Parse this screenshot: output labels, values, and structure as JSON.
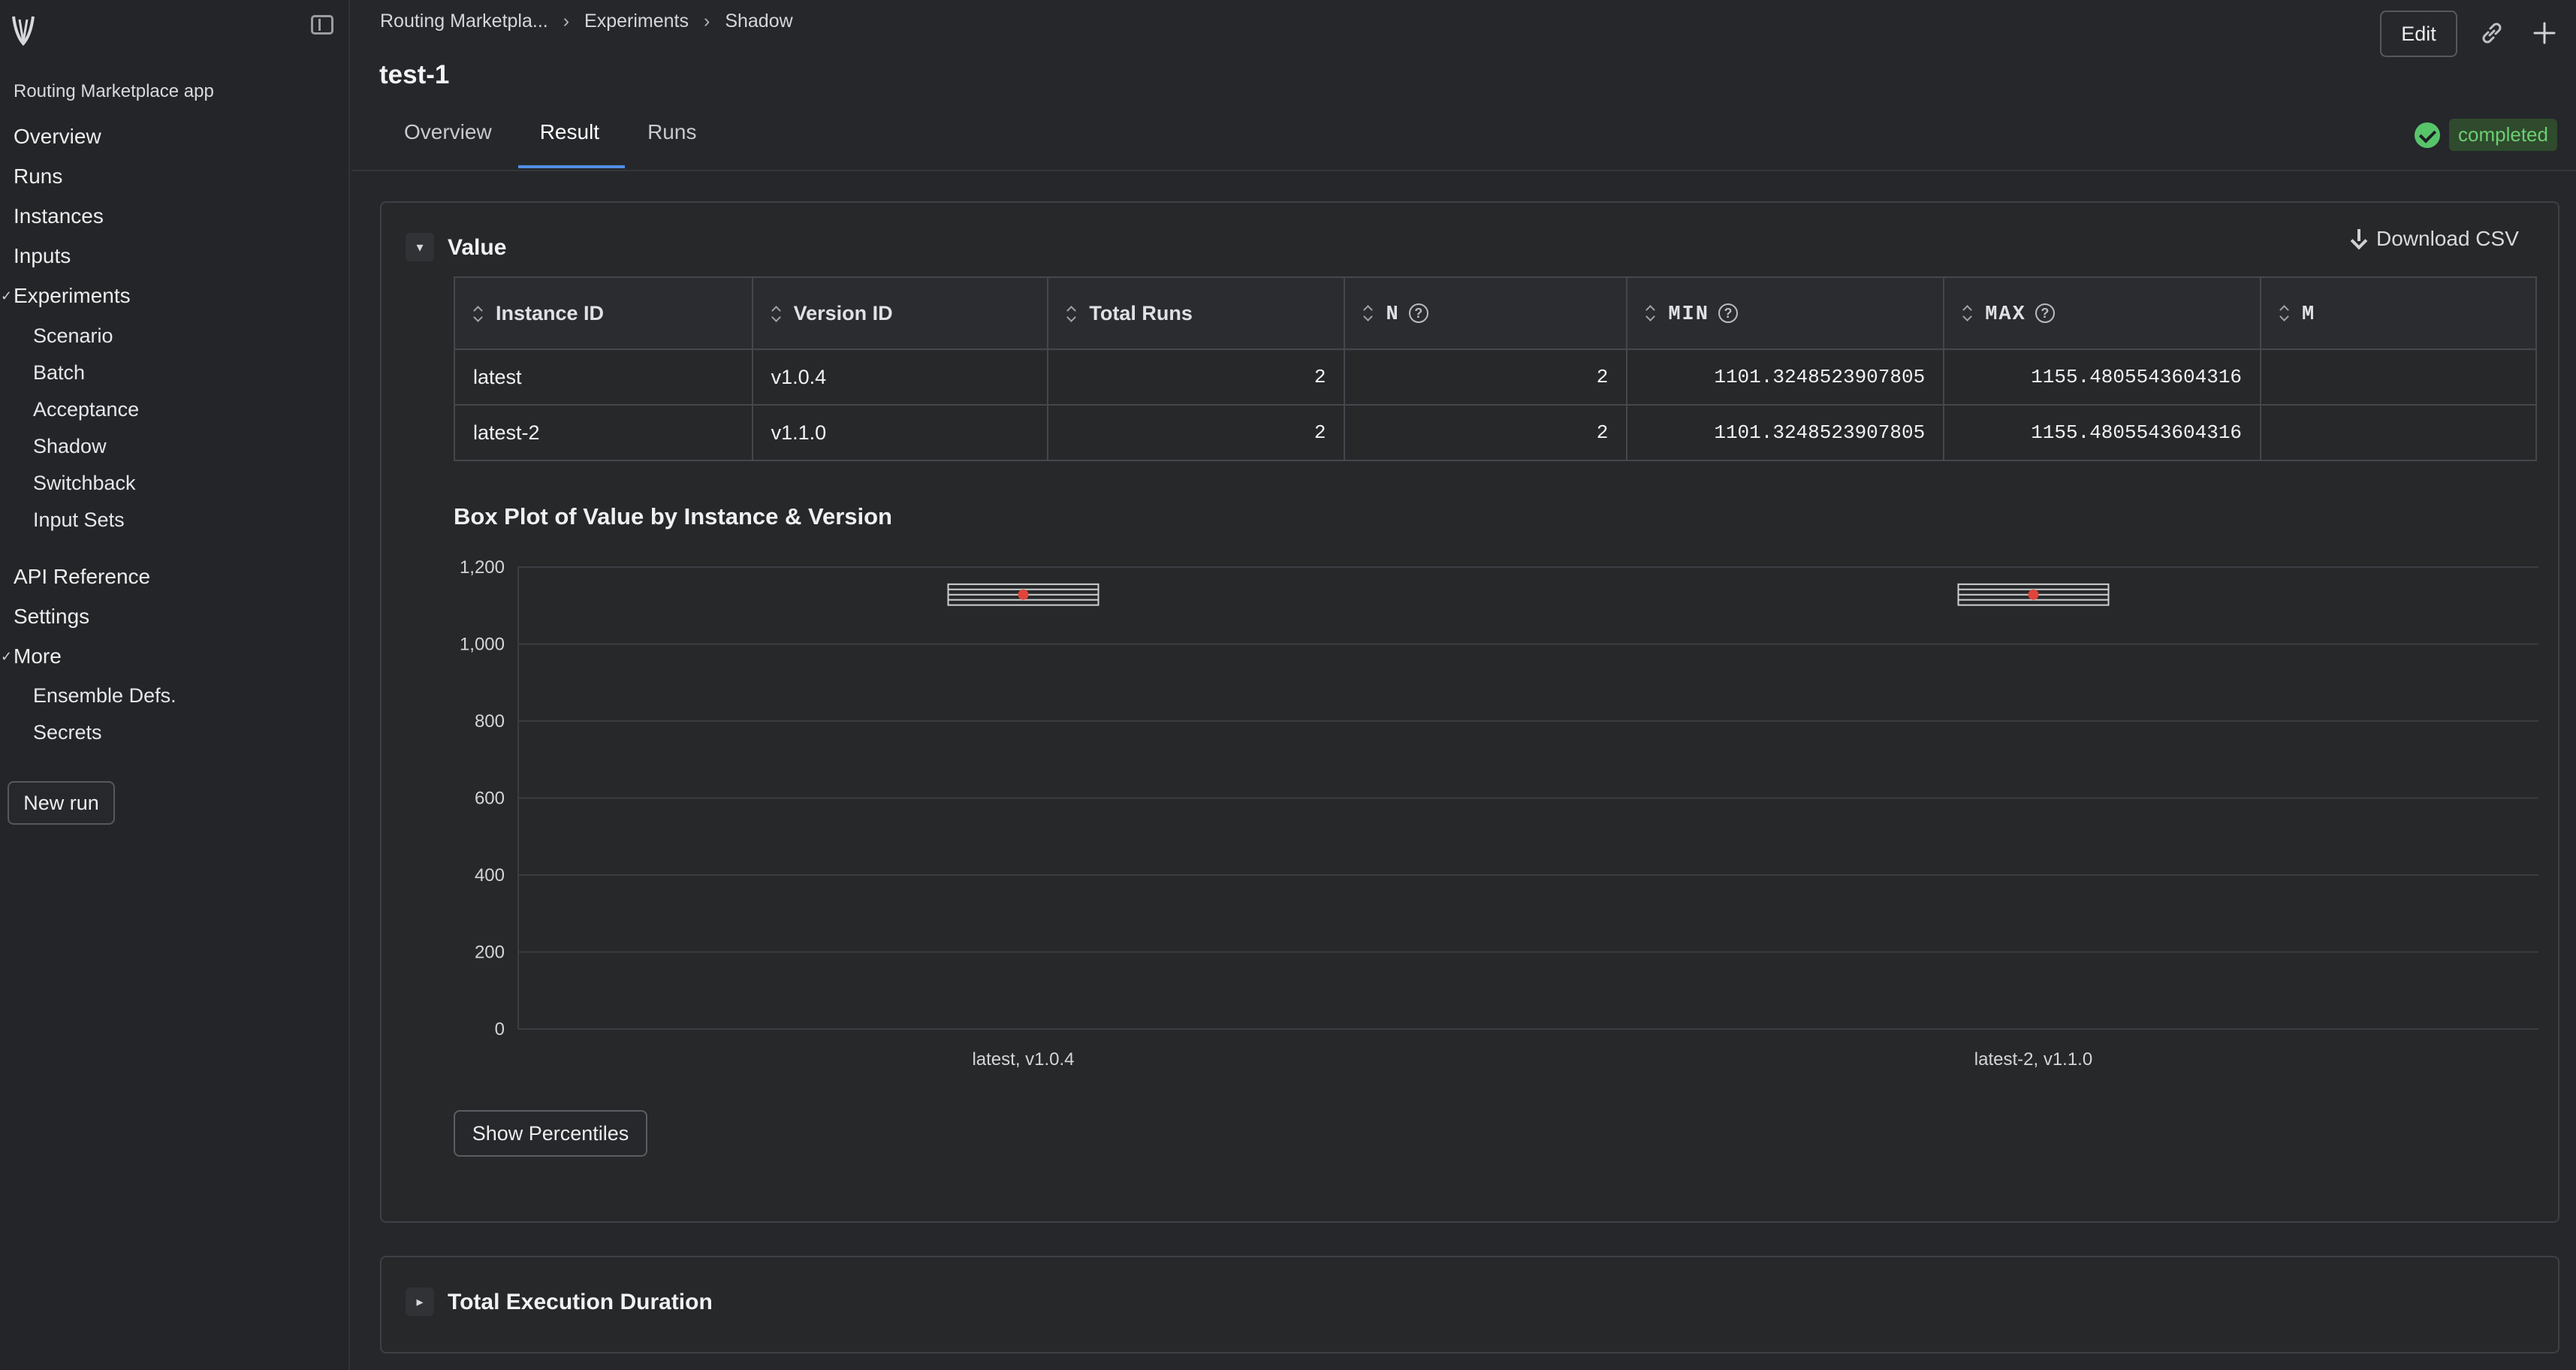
{
  "sidebar": {
    "app_name": "Routing Marketplace app",
    "items": [
      {
        "label": "Overview"
      },
      {
        "label": "Runs"
      },
      {
        "label": "Instances"
      },
      {
        "label": "Inputs"
      },
      {
        "label": "Experiments"
      },
      {
        "label": "API Reference"
      },
      {
        "label": "Settings"
      },
      {
        "label": "More"
      }
    ],
    "experiments_sub": [
      "Scenario",
      "Batch",
      "Acceptance",
      "Shadow",
      "Switchback",
      "Input Sets"
    ],
    "more_sub": [
      "Ensemble Defs.",
      "Secrets"
    ],
    "new_run": "New run"
  },
  "header": {
    "breadcrumbs": [
      "Routing Marketpla...",
      "Experiments",
      "Shadow"
    ],
    "title": "test-1",
    "edit": "Edit",
    "tabs": [
      "Overview",
      "Result",
      "Runs"
    ],
    "active_tab": "Result",
    "status": "completed"
  },
  "value_section": {
    "title": "Value",
    "download": "Download CSV",
    "columns": [
      "Instance ID",
      "Version ID",
      "Total Runs",
      "N",
      "MIN",
      "MAX",
      "M"
    ],
    "rows": [
      {
        "instance": "latest",
        "version": "v1.0.4",
        "total_runs": "2",
        "n": "2",
        "min": "1101.3248523907805",
        "max": "1155.4805543604316"
      },
      {
        "instance": "latest-2",
        "version": "v1.1.0",
        "total_runs": "2",
        "n": "2",
        "min": "1101.3248523907805",
        "max": "1155.4805543604316"
      }
    ],
    "plot_title": "Box Plot of Value by Instance & Version",
    "show_percentiles": "Show Percentiles"
  },
  "chart_data": {
    "type": "box",
    "title": "Box Plot of Value by Instance & Version",
    "categories": [
      "latest, v1.0.4",
      "latest-2, v1.1.0"
    ],
    "ylim": [
      0,
      1200
    ],
    "yticks": [
      "0",
      "200",
      "400",
      "600",
      "800",
      "1,000",
      "1,200"
    ],
    "boxes": [
      {
        "min": 1101.3248523907805,
        "max": 1155.4805543604316,
        "mean": 1128.4
      },
      {
        "min": 1101.3248523907805,
        "max": 1155.4805543604316,
        "mean": 1128.4
      }
    ],
    "grid": true
  },
  "duration_section": {
    "title": "Total Execution Duration"
  }
}
